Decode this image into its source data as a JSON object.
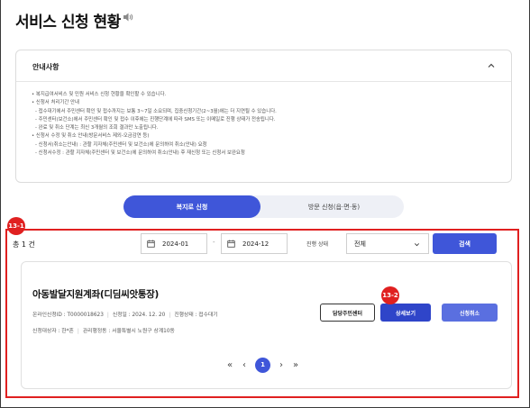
{
  "page": {
    "title": "서비스 신청 현황"
  },
  "notice": {
    "title": "안내사항",
    "lines": [
      "• 복지급여서비스 및 민원 서비스 신청 현황을 확인할 수 있습니다.",
      "• 신청서 처리기간 안내",
      "- 접수대기에서 주민센터 확인 및 접수까지는 보통 3~7일 소요되며, 집중신청기간(2~3월)에는 더 지연될 수 있습니다.",
      "- 주민센터(보건소)에서 주민센터 확인 및 접수 이후에는 진행단계에 따라 SMS 또는 이메일로 진행 상태가 전송됩니다.",
      "- 완료 및 취소 단계는 최신 3개월의 조회 결과만 노출됩니다.",
      "• 신청서 수정 및 취소 안내(방문서비스 제외-오금감연 등)",
      "- 신청서(취소는안내) : 관할 지자체(주민센터 및 보건소)에 문의하여 취소(안내) 요청",
      "- 신청서수정 : 관할 지자체(주민센터 및 보건소)에 문의하여 취소(안내) 후 재신청 또는 신청서 보완요청"
    ]
  },
  "tabs": [
    {
      "label": "복지로 신청",
      "active": true
    },
    {
      "label": "방문 신청(읍·면·동)",
      "active": false
    }
  ],
  "markers": {
    "filter": "13-1",
    "detail": "13-2"
  },
  "filter": {
    "count": "총 1 건",
    "date_from": "2024-01",
    "date_separator": "-",
    "date_to": "2024-12",
    "status_label": "진행 상태",
    "status_value": "전체",
    "search_label": "검색"
  },
  "results": [
    {
      "title": "아동발달지원계좌(디딤씨앗통장)",
      "online_no": "온라인신청ID : T0000018623",
      "applied_date": "신청일 : 2024. 12. 20",
      "status": "진행상태 : 접수대기",
      "applicant": "신청대상자 : 한*흔",
      "office": "관리행정동 : 서울특별시 노원구 상계10동",
      "buttons": {
        "center": "담당주민센터",
        "detail": "상세보기",
        "cancel": "신청취소"
      }
    }
  ],
  "pagination": {
    "first": "«",
    "prev": "‹",
    "current": "1",
    "next": "›",
    "last": "»"
  },
  "colors": {
    "accent": "#3f56d9",
    "highlight": "#e02020"
  }
}
